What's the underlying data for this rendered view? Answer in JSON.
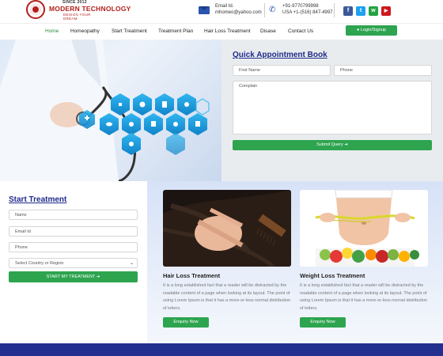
{
  "brand": {
    "since": "SINCE 2012",
    "name": "MODERN TECHNOLOGY",
    "tagline": "DESIGN YOUR DREAM"
  },
  "contact": {
    "email_label": "Email Id.",
    "email_value": "mhomeo@yahoo.com",
    "phone_1": "+91-9770799998",
    "phone_2": "USA +1-(516) 847-4997"
  },
  "social": {
    "facebook": "f",
    "twitter": "t",
    "whatsapp": "w",
    "youtube": "▶",
    "colors": {
      "facebook": "#3b5998",
      "twitter": "#1da1f2",
      "whatsapp": "#25a244",
      "youtube": "#cc181e"
    }
  },
  "nav": {
    "items": [
      "Home",
      "Homeopathy",
      "Start Treatment",
      "Treatment Plan",
      "Hair Loss Treatment",
      "Disase",
      "Contact Us"
    ],
    "login_label": "Login/Signup"
  },
  "appointment": {
    "title": "Quick Appointment Book",
    "first_name_placeholder": "First Name",
    "phone_placeholder": "Phone",
    "complain_placeholder": "Complain",
    "submit_label": "Submit Query"
  },
  "start_treatment": {
    "title": "Start Treatment",
    "name_placeholder": "Name",
    "email_placeholder": "Email Id",
    "phone_placeholder": "Phone",
    "country_select": "Select Country or Region",
    "button_label": "START MY TREATMENT"
  },
  "cards": [
    {
      "title": "Hair Loss Treatment",
      "description": "It is a long established fact that a reader will be distracted by the readable content of a page when looking at its layout. The point of using Lorem Ipsum is that it has a more-or-less normal distribution of letters.",
      "button": "Enquiry Now"
    },
    {
      "title": "Weight Loss Treatment",
      "description": "It is a long established fact that a reader will be distracted by the readable content of a page when looking at its layout. The point of using Lorem Ipsum is that it has a more-or-less normal distribution of letters.",
      "button": "Enquiry Now"
    }
  ],
  "colors": {
    "accent_green": "#2ea44f",
    "title_blue": "#1f2b8a",
    "brand_red": "#b3201c",
    "footer_blue": "#24308f"
  }
}
